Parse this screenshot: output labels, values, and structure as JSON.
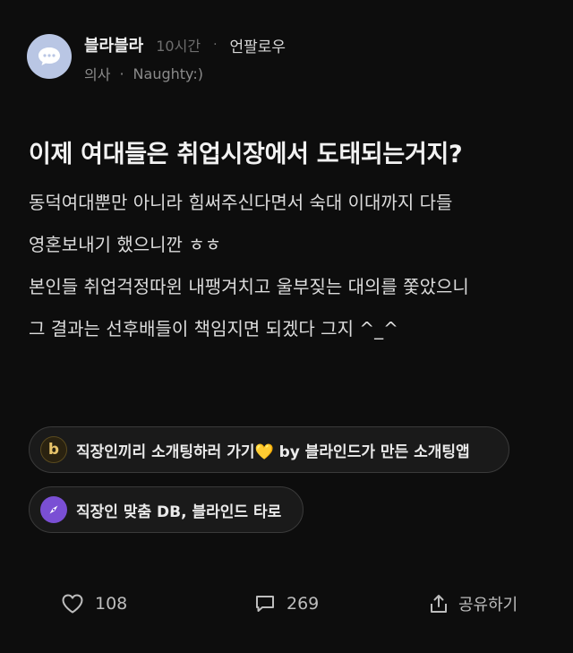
{
  "post": {
    "author": "블라블라",
    "time": "10시간",
    "separator": "·",
    "follow_label": "언팔로우",
    "job": "의사",
    "nickname": "Naughty:)",
    "title": "이제 여대들은 취업시장에서 도태되는거지?",
    "body_lines": [
      "동덕여대뿐만 아니라 힘써주신다면서 숙대 이대까지 다들",
      "영혼보내기 했으니깐 ㅎㅎ",
      "본인들 취업걱정따윈 내팽겨치고 울부짖는 대의를 쫓았으니",
      "그 결과는 선후배들이 책임지면 되겠다 그지 ^_^"
    ]
  },
  "promos": [
    {
      "icon": "b",
      "icon_name": "blind-b-icon",
      "label": "직장인끼리 소개팅하러 가기💛 by 블라인드가 만든 소개팅앱"
    },
    {
      "icon": "tarot-icon",
      "label": "직장인 맞춤 DB, 블라인드 타로"
    }
  ],
  "actions": {
    "likes": "108",
    "comments": "269",
    "share_label": "공유하기"
  },
  "colors": {
    "background": "#0d0d0d",
    "avatar": "#b9c6e4",
    "tarot_accent": "#7a4fd4",
    "blind_accent": "#e8c46a"
  }
}
